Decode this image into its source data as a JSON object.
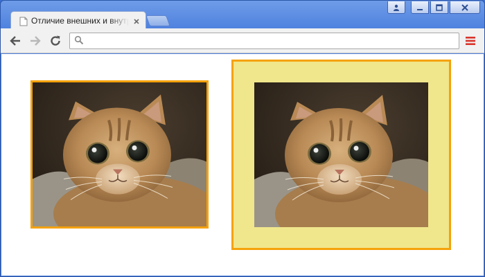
{
  "window": {
    "caption_buttons": [
      "user-icon",
      "minimize-icon",
      "maximize-icon",
      "close-icon"
    ]
  },
  "tab": {
    "title": "Отличие внешних и внутренних отступов",
    "icon": "page-icon"
  },
  "toolbar": {
    "omnibox_value": "",
    "icons": [
      "back-arrow-icon",
      "forward-arrow-icon",
      "reload-icon",
      "search-icon",
      "menu-icon"
    ]
  },
  "page": {
    "images": [
      {
        "name": "cat photo with margin",
        "border_color": "#f5a20a"
      },
      {
        "name": "cat photo with padding",
        "border_color": "#f5a20a",
        "background_color": "#f0e68c"
      }
    ]
  }
}
